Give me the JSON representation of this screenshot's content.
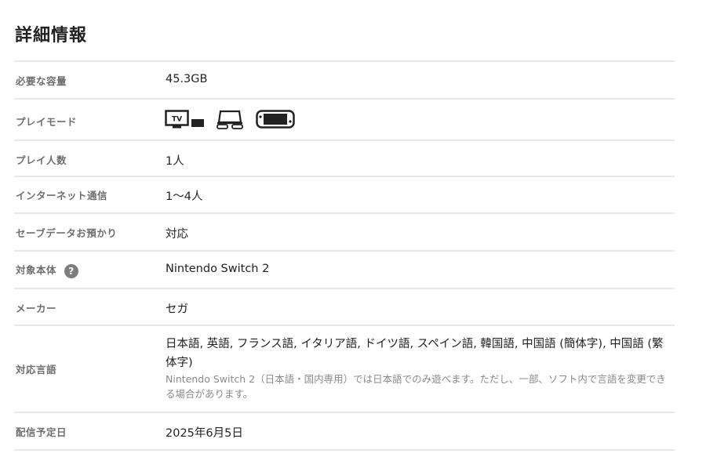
{
  "section": {
    "title": "詳細情報"
  },
  "rows": {
    "capacity": {
      "label": "必要な容量",
      "value": "45.3GB"
    },
    "play_mode": {
      "label": "プレイモード",
      "icons": [
        "tv-mode-icon",
        "tabletop-mode-icon",
        "handheld-mode-icon"
      ],
      "tv_text": "TV"
    },
    "players": {
      "label": "プレイ人数",
      "value": "1人"
    },
    "online": {
      "label": "インターネット通信",
      "value": "1〜4人"
    },
    "save_data": {
      "label": "セーブデータお預かり",
      "value": "対応"
    },
    "target": {
      "label": "対象本体",
      "help": "?",
      "value": "Nintendo Switch 2"
    },
    "maker": {
      "label": "メーカー",
      "value": "セガ"
    },
    "languages": {
      "label": "対応言語",
      "value": "日本語, 英語, フランス語, イタリア語, ドイツ語, スペイン語, 韓国語, 中国語 (簡体字), 中国語 (繁体字)",
      "note": "Nintendo Switch 2（日本語・国内専用）では日本語でのみ遊べます。ただし、一部、ソフト内で言語を変更できる場合があります。"
    },
    "release": {
      "label": "配信予定日",
      "value": "2025年6月5日"
    }
  }
}
